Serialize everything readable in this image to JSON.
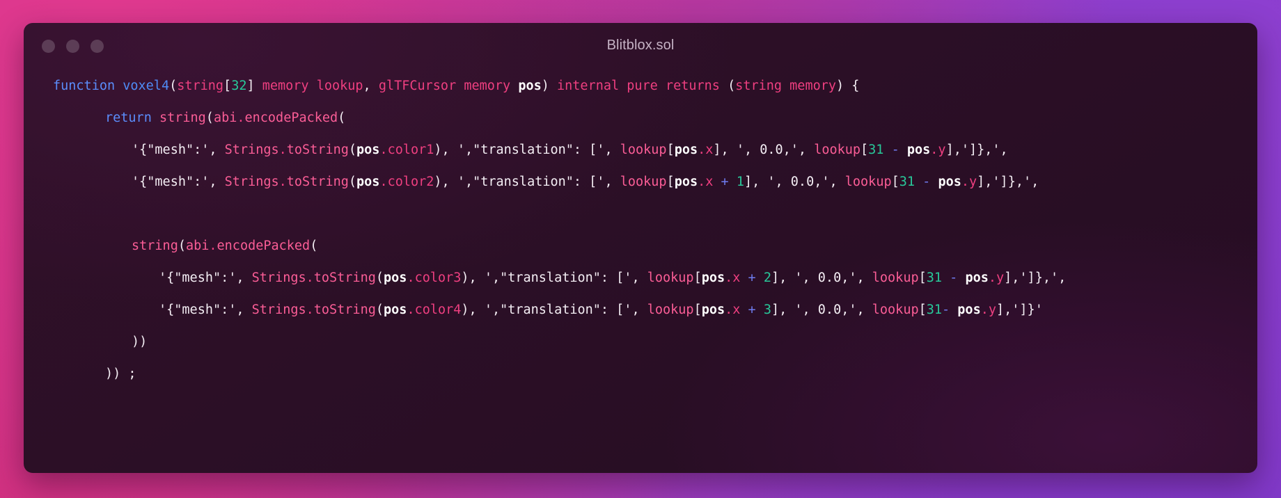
{
  "window": {
    "title": "Blitblox.sol",
    "traffic_lights": [
      "close-dot",
      "minimize-dot",
      "zoom-dot"
    ],
    "dot_color": "#5c3d56",
    "title_color": "#c5b2c4",
    "background_gradient": [
      "#d8348b",
      "#ad37a4",
      "#9a3cbc",
      "#7d38c9"
    ],
    "editor_background": "#2b0f26"
  },
  "theme": {
    "keyword": "#5b8dfb",
    "function": "#4f8cf7",
    "type": "#ef3f80",
    "number": "#28c99a",
    "punctuation": "#f4eef4",
    "string": "#f4eef4",
    "identifier": "#fb5d96",
    "property": "#ef3f80",
    "variable": "#ffffff",
    "operator": "#6f7cf0"
  },
  "code": {
    "language": "solidity",
    "plain_text": "function voxel4(string[32] memory lookup, glTFCursor memory pos) internal pure returns (string memory) {\n    return string(abi.encodePacked(\n        '{\"mesh\":', Strings.toString(pos.color1), ',\"translation\": [', lookup[pos.x], ', 0.0,', lookup[31 - pos.y],']},',\n        '{\"mesh\":', Strings.toString(pos.color2), ',\"translation\": [', lookup[pos.x + 1], ', 0.0,', lookup[31 - pos.y],']},',\n\n        string(abi.encodePacked(\n            '{\"mesh\":', Strings.toString(pos.color3), ',\"translation\": [', lookup[pos.x + 2], ', 0.0,', lookup[31 - pos.y],']},',\n            '{\"mesh\":', Strings.toString(pos.color4), ',\"translation\": [', lookup[pos.x + 3], ', 0.0,', lookup[31- pos.y],']}'\n        ))\n    )) ;",
    "lines": [
      {
        "indent": 0,
        "tokens": [
          {
            "t": "function",
            "c": "kw"
          },
          {
            "t": " ",
            "c": "plain"
          },
          {
            "t": "voxel4",
            "c": "fn"
          },
          {
            "t": "(",
            "c": "punct"
          },
          {
            "t": "string",
            "c": "type"
          },
          {
            "t": "[",
            "c": "punct"
          },
          {
            "t": "32",
            "c": "num"
          },
          {
            "t": "]",
            "c": "punct"
          },
          {
            "t": " memory lookup",
            "c": "type"
          },
          {
            "t": ",",
            "c": "punct"
          },
          {
            "t": " glTFCursor memory ",
            "c": "type"
          },
          {
            "t": "pos",
            "c": "var"
          },
          {
            "t": ")",
            "c": "punct"
          },
          {
            "t": " internal pure returns ",
            "c": "type"
          },
          {
            "t": "(",
            "c": "punct"
          },
          {
            "t": "string memory",
            "c": "type"
          },
          {
            "t": ") {",
            "c": "punct"
          }
        ]
      },
      {
        "indent": 1,
        "tokens": [
          {
            "t": "return",
            "c": "kw"
          },
          {
            "t": " ",
            "c": "plain"
          },
          {
            "t": "string",
            "c": "ident"
          },
          {
            "t": "(",
            "c": "punct"
          },
          {
            "t": "abi",
            "c": "ident"
          },
          {
            "t": ".",
            "c": "prop"
          },
          {
            "t": "encodePacked",
            "c": "ident"
          },
          {
            "t": "(",
            "c": "punct"
          }
        ]
      },
      {
        "indent": 2,
        "tokens": [
          {
            "t": "'{\"mesh\":', ",
            "c": "str"
          },
          {
            "t": "Strings",
            "c": "ident"
          },
          {
            "t": ".",
            "c": "prop"
          },
          {
            "t": "toString",
            "c": "ident"
          },
          {
            "t": "(",
            "c": "punct"
          },
          {
            "t": "pos",
            "c": "var"
          },
          {
            "t": ".color1",
            "c": "prop"
          },
          {
            "t": "), ",
            "c": "punct"
          },
          {
            "t": "',\"translation\": [', ",
            "c": "str"
          },
          {
            "t": "lookup",
            "c": "ident"
          },
          {
            "t": "[",
            "c": "punct"
          },
          {
            "t": "pos",
            "c": "var"
          },
          {
            "t": ".x",
            "c": "prop"
          },
          {
            "t": "], ', 0.0,', ",
            "c": "str"
          },
          {
            "t": "lookup",
            "c": "ident"
          },
          {
            "t": "[",
            "c": "punct"
          },
          {
            "t": "31",
            "c": "num"
          },
          {
            "t": " ",
            "c": "plain"
          },
          {
            "t": "-",
            "c": "op"
          },
          {
            "t": " ",
            "c": "plain"
          },
          {
            "t": "pos",
            "c": "var"
          },
          {
            "t": ".y",
            "c": "prop"
          },
          {
            "t": "],']},',",
            "c": "str"
          }
        ]
      },
      {
        "indent": 2,
        "tokens": [
          {
            "t": "'{\"mesh\":', ",
            "c": "str"
          },
          {
            "t": "Strings",
            "c": "ident"
          },
          {
            "t": ".",
            "c": "prop"
          },
          {
            "t": "toString",
            "c": "ident"
          },
          {
            "t": "(",
            "c": "punct"
          },
          {
            "t": "pos",
            "c": "var"
          },
          {
            "t": ".color2",
            "c": "prop"
          },
          {
            "t": "), ",
            "c": "punct"
          },
          {
            "t": "',\"translation\": [', ",
            "c": "str"
          },
          {
            "t": "lookup",
            "c": "ident"
          },
          {
            "t": "[",
            "c": "punct"
          },
          {
            "t": "pos",
            "c": "var"
          },
          {
            "t": ".x",
            "c": "prop"
          },
          {
            "t": " ",
            "c": "plain"
          },
          {
            "t": "+",
            "c": "op"
          },
          {
            "t": " ",
            "c": "plain"
          },
          {
            "t": "1",
            "c": "num"
          },
          {
            "t": "], ', 0.0,', ",
            "c": "str"
          },
          {
            "t": "lookup",
            "c": "ident"
          },
          {
            "t": "[",
            "c": "punct"
          },
          {
            "t": "31",
            "c": "num"
          },
          {
            "t": " ",
            "c": "plain"
          },
          {
            "t": "-",
            "c": "op"
          },
          {
            "t": " ",
            "c": "plain"
          },
          {
            "t": "pos",
            "c": "var"
          },
          {
            "t": ".y",
            "c": "prop"
          },
          {
            "t": "],']},',",
            "c": "str"
          }
        ]
      },
      {
        "indent": 0,
        "tokens": []
      },
      {
        "indent": 2,
        "tokens": [
          {
            "t": "string",
            "c": "ident"
          },
          {
            "t": "(",
            "c": "punct"
          },
          {
            "t": "abi",
            "c": "ident"
          },
          {
            "t": ".",
            "c": "prop"
          },
          {
            "t": "encodePacked",
            "c": "ident"
          },
          {
            "t": "(",
            "c": "punct"
          }
        ]
      },
      {
        "indent": 3,
        "tokens": [
          {
            "t": "'{\"mesh\":', ",
            "c": "str"
          },
          {
            "t": "Strings",
            "c": "ident"
          },
          {
            "t": ".",
            "c": "prop"
          },
          {
            "t": "toString",
            "c": "ident"
          },
          {
            "t": "(",
            "c": "punct"
          },
          {
            "t": "pos",
            "c": "var"
          },
          {
            "t": ".color3",
            "c": "prop"
          },
          {
            "t": "), ",
            "c": "punct"
          },
          {
            "t": "',\"translation\": [', ",
            "c": "str"
          },
          {
            "t": "lookup",
            "c": "ident"
          },
          {
            "t": "[",
            "c": "punct"
          },
          {
            "t": "pos",
            "c": "var"
          },
          {
            "t": ".x",
            "c": "prop"
          },
          {
            "t": " ",
            "c": "plain"
          },
          {
            "t": "+",
            "c": "op"
          },
          {
            "t": " ",
            "c": "plain"
          },
          {
            "t": "2",
            "c": "num"
          },
          {
            "t": "], ', 0.0,', ",
            "c": "str"
          },
          {
            "t": "lookup",
            "c": "ident"
          },
          {
            "t": "[",
            "c": "punct"
          },
          {
            "t": "31",
            "c": "num"
          },
          {
            "t": " ",
            "c": "plain"
          },
          {
            "t": "-",
            "c": "op"
          },
          {
            "t": " ",
            "c": "plain"
          },
          {
            "t": "pos",
            "c": "var"
          },
          {
            "t": ".y",
            "c": "prop"
          },
          {
            "t": "],']},',",
            "c": "str"
          }
        ]
      },
      {
        "indent": 3,
        "tokens": [
          {
            "t": "'{\"mesh\":', ",
            "c": "str"
          },
          {
            "t": "Strings",
            "c": "ident"
          },
          {
            "t": ".",
            "c": "prop"
          },
          {
            "t": "toString",
            "c": "ident"
          },
          {
            "t": "(",
            "c": "punct"
          },
          {
            "t": "pos",
            "c": "var"
          },
          {
            "t": ".color4",
            "c": "prop"
          },
          {
            "t": "), ",
            "c": "punct"
          },
          {
            "t": "',\"translation\": [', ",
            "c": "str"
          },
          {
            "t": "lookup",
            "c": "ident"
          },
          {
            "t": "[",
            "c": "punct"
          },
          {
            "t": "pos",
            "c": "var"
          },
          {
            "t": ".x",
            "c": "prop"
          },
          {
            "t": " ",
            "c": "plain"
          },
          {
            "t": "+",
            "c": "op"
          },
          {
            "t": " ",
            "c": "plain"
          },
          {
            "t": "3",
            "c": "num"
          },
          {
            "t": "], ', 0.0,', ",
            "c": "str"
          },
          {
            "t": "lookup",
            "c": "ident"
          },
          {
            "t": "[",
            "c": "punct"
          },
          {
            "t": "31",
            "c": "num"
          },
          {
            "t": "-",
            "c": "op"
          },
          {
            "t": " ",
            "c": "plain"
          },
          {
            "t": "pos",
            "c": "var"
          },
          {
            "t": ".y",
            "c": "prop"
          },
          {
            "t": "],']}'",
            "c": "str"
          }
        ]
      },
      {
        "indent": 2,
        "tokens": [
          {
            "t": "))",
            "c": "punct"
          }
        ]
      },
      {
        "indent": 1,
        "tokens": [
          {
            "t": ")) ;",
            "c": "punct"
          }
        ]
      }
    ]
  }
}
